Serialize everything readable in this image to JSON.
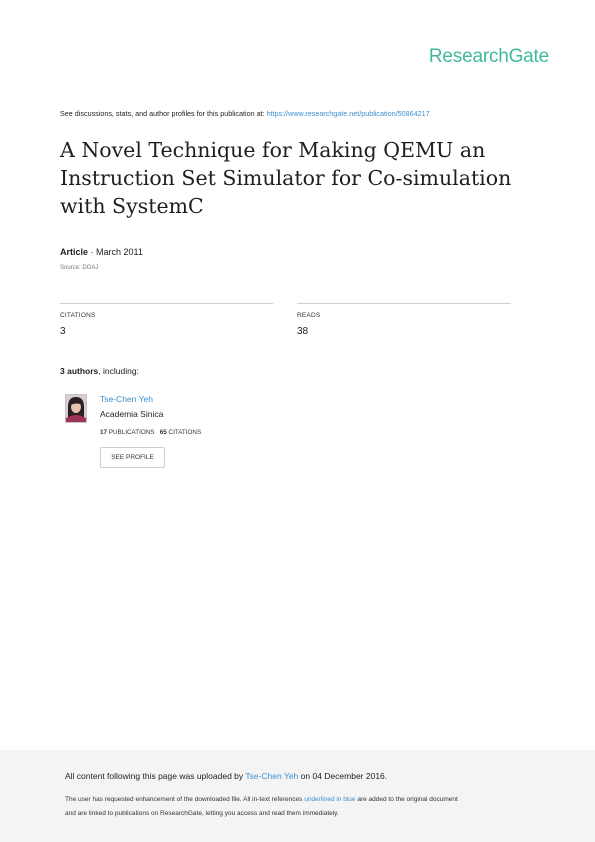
{
  "brand": {
    "logo_text": "ResearchGate",
    "accent_color": "#40ba9b",
    "link_color": "#3b8fd0"
  },
  "header": {
    "see_text": "See discussions, stats, and author profiles for this publication at:",
    "url": "https://www.researchgate.net/publication/50864217"
  },
  "publication": {
    "title_line1": "A Novel Technique for Making QEMU an",
    "title_line2": "Instruction Set Simulator for Co-simulation",
    "title_line3": "with SystemC",
    "type": "Article",
    "date": " · March 2011",
    "source": "Source: DOAJ"
  },
  "stats": {
    "citations_label": "CITATIONS",
    "citations_value": "3",
    "reads_label": "READS",
    "reads_value": "38"
  },
  "authors": {
    "count_text": "3 authors",
    "including_text": ", including:",
    "list": [
      {
        "name": "Tse-Chen Yeh",
        "institution": "Academia Sinica",
        "publications_count": "17",
        "publications_label": "PUBLICATIONS",
        "citations_count": "65",
        "citations_label": "CITATIONS",
        "profile_button": "SEE PROFILE"
      }
    ]
  },
  "footer": {
    "upload_prefix": "All content following this page was uploaded by ",
    "uploader": "Tse-Chen Yeh",
    "upload_suffix": " on 04 December 2016.",
    "note_line1_prefix": "The user has requested enhancement of the downloaded file. All in-text references ",
    "note_line1_link": "underlined in blue",
    "note_line1_suffix": " are added to the original document",
    "note_line2": "and are linked to publications on ResearchGate, letting you access and read them immediately."
  }
}
